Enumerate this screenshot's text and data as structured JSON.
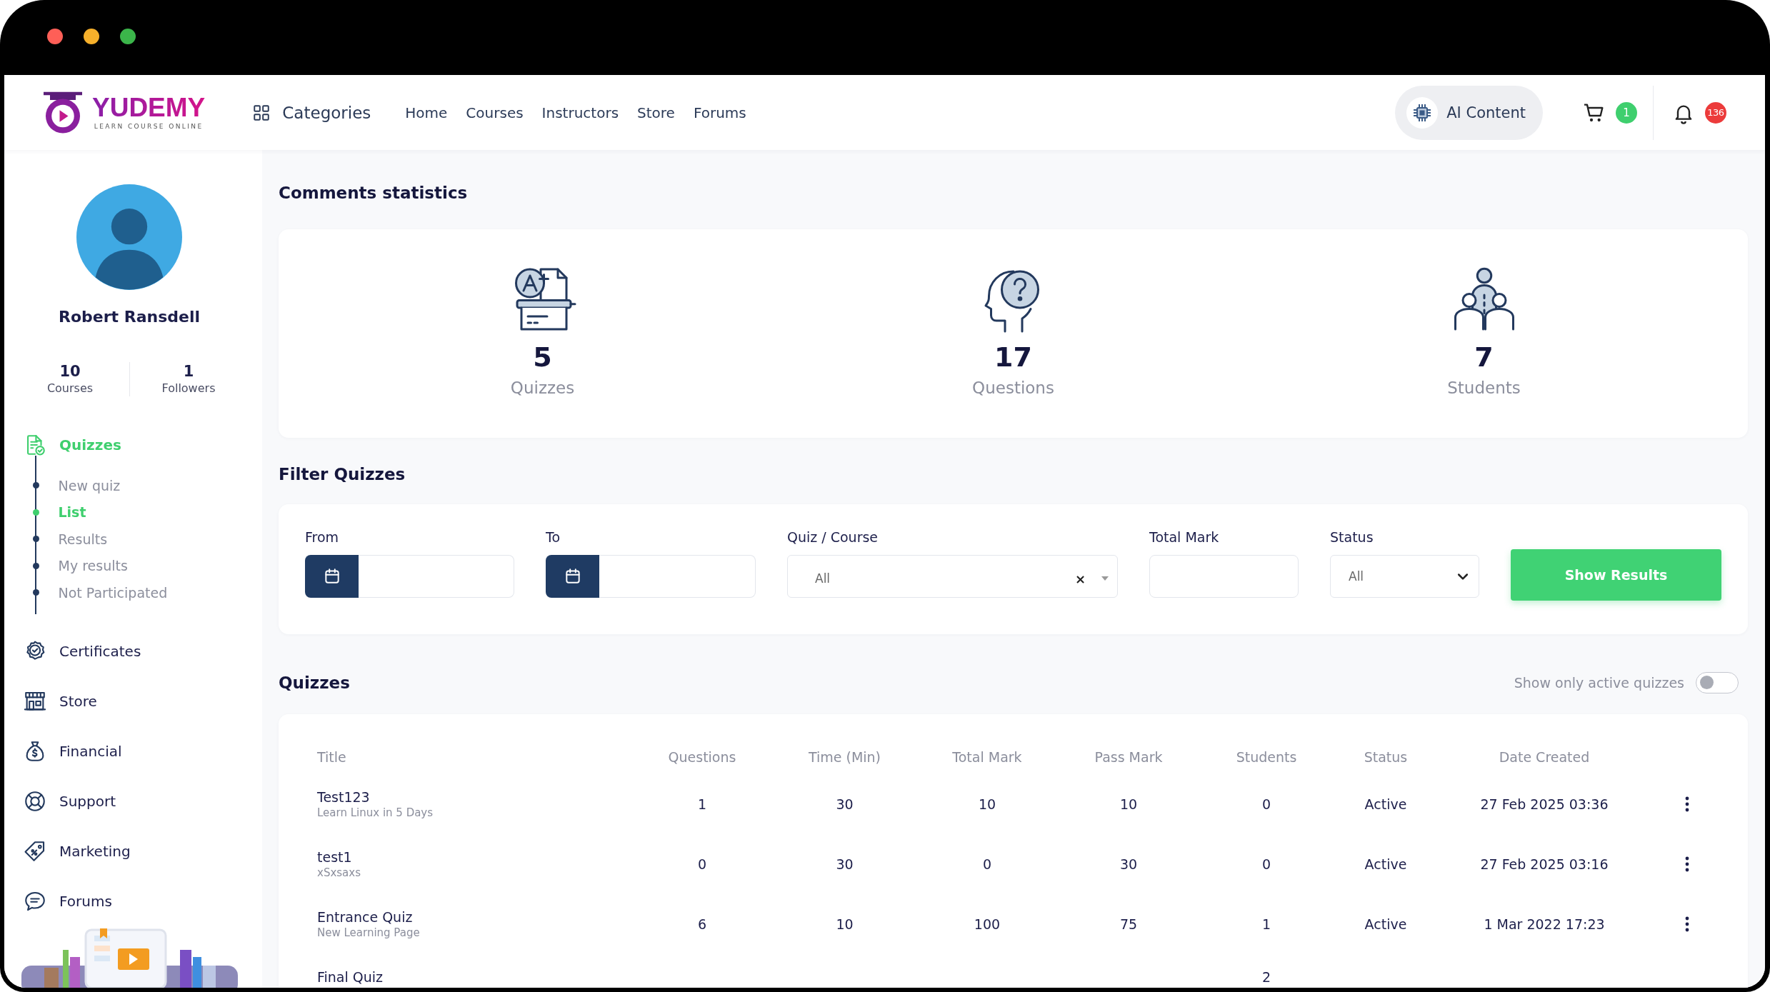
{
  "header": {
    "logo": {
      "name": "YUDEMY",
      "tagline": "LEARN COURSE ONLINE"
    },
    "categories": "Categories",
    "nav": [
      {
        "label": "Home"
      },
      {
        "label": "Courses"
      },
      {
        "label": "Instructors"
      },
      {
        "label": "Store"
      },
      {
        "label": "Forums"
      }
    ],
    "ai_button": "AI Content",
    "cart_count": "1",
    "notification_count": "136"
  },
  "profile": {
    "name": "Robert Ransdell",
    "stats": [
      {
        "value": "10",
        "label": "Courses"
      },
      {
        "value": "1",
        "label": "Followers"
      }
    ]
  },
  "sidebar": {
    "items": [
      {
        "label": "Quizzes",
        "selected": true,
        "children": [
          {
            "label": "New quiz",
            "selected": false
          },
          {
            "label": "List",
            "selected": true
          },
          {
            "label": "Results",
            "selected": false
          },
          {
            "label": "My results",
            "selected": false
          },
          {
            "label": "Not Participated",
            "selected": false
          }
        ]
      },
      {
        "label": "Certificates",
        "selected": false
      },
      {
        "label": "Store",
        "selected": false
      },
      {
        "label": "Financial",
        "selected": false
      },
      {
        "label": "Support",
        "selected": false
      },
      {
        "label": "Marketing",
        "selected": false
      },
      {
        "label": "Forums",
        "selected": false
      }
    ]
  },
  "statistics": {
    "title": "Comments statistics",
    "items": [
      {
        "value": "5",
        "label": "Quizzes"
      },
      {
        "value": "17",
        "label": "Questions"
      },
      {
        "value": "7",
        "label": "Students"
      }
    ]
  },
  "filter": {
    "title": "Filter Quizzes",
    "fields": [
      {
        "kind": "date",
        "label": "From"
      },
      {
        "kind": "date",
        "label": "To"
      },
      {
        "kind": "search_select",
        "label": "Quiz / Course",
        "value": "All",
        "clear": "×"
      },
      {
        "kind": "text",
        "label": "Total Mark"
      },
      {
        "kind": "select",
        "label": "Status",
        "value": "All"
      }
    ],
    "button": "Show Results"
  },
  "quizzes": {
    "title": "Quizzes",
    "toggle": {
      "label": "Show only active quizzes",
      "on": false
    },
    "columns": [
      "Title",
      "Questions",
      "Time (Min)",
      "Total Mark",
      "Pass Mark",
      "Students",
      "Status",
      "Date Created"
    ],
    "rows": [
      {
        "title": "Test123",
        "course": "Learn Linux in 5 Days",
        "questions": "1",
        "time": "30",
        "total_mark": "10",
        "pass_mark": "10",
        "students": "0",
        "status": "Active",
        "date_created": "27 Feb 2025 03:36",
        "menu": true
      },
      {
        "title": "test1",
        "course": "xSxsaxs",
        "questions": "0",
        "time": "30",
        "total_mark": "0",
        "pass_mark": "30",
        "students": "0",
        "status": "Active",
        "date_created": "27 Feb 2025 03:16",
        "menu": true
      },
      {
        "title": "Entrance Quiz",
        "course": "New Learning Page",
        "questions": "6",
        "time": "10",
        "total_mark": "100",
        "pass_mark": "75",
        "students": "1",
        "status": "Active",
        "date_created": "1 Mar 2022 17:23",
        "menu": true
      },
      {
        "title": "Final Quiz",
        "students": "2",
        "menu": false
      }
    ]
  }
}
